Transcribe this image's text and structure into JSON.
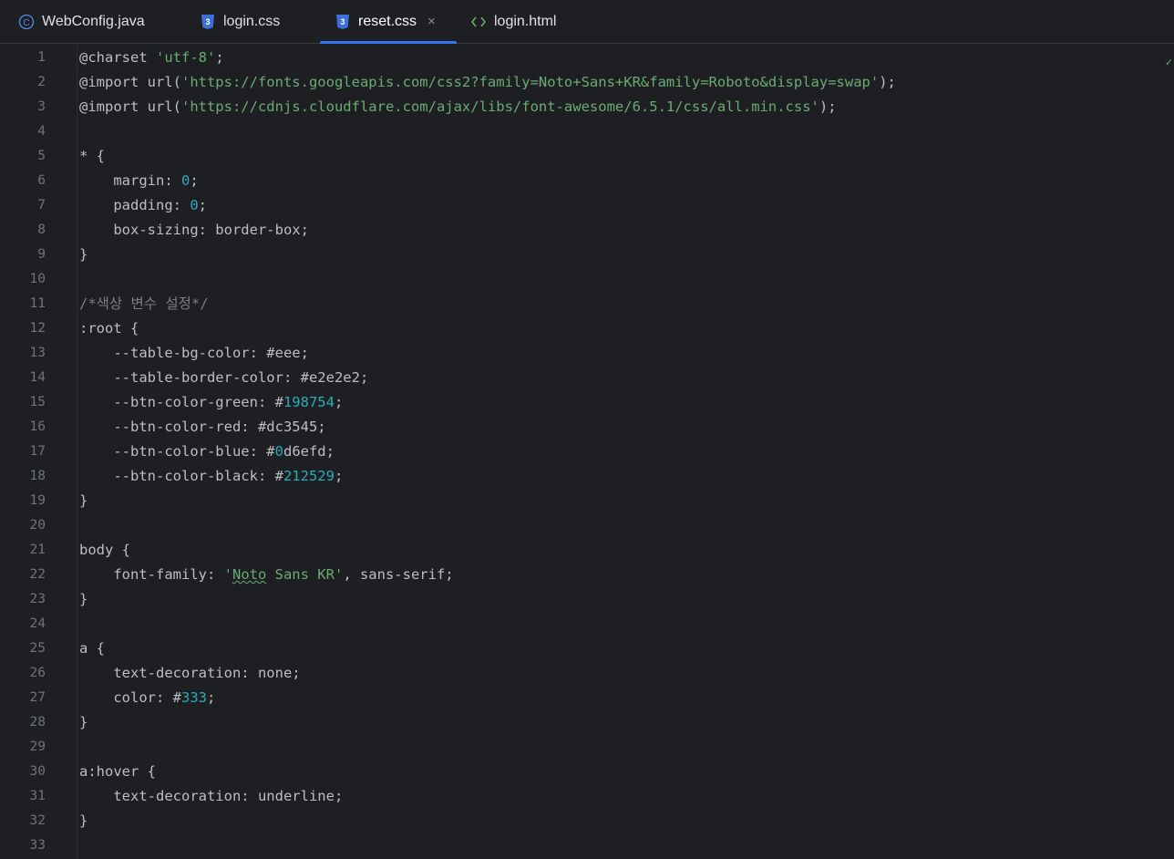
{
  "tabs": [
    {
      "label": "WebConfig.java",
      "icon": "java-class-icon",
      "active": false
    },
    {
      "label": "login.css",
      "icon": "css-file-icon",
      "active": false
    },
    {
      "label": "reset.css",
      "icon": "css-file-icon",
      "active": true,
      "close": "×"
    },
    {
      "label": "login.html",
      "icon": "html-file-icon",
      "active": false
    }
  ],
  "editor": {
    "file": "reset.css",
    "gutter_mark": "✓",
    "lines": [
      {
        "n": "1"
      },
      {
        "n": "2"
      },
      {
        "n": "3"
      },
      {
        "n": "4"
      },
      {
        "n": "5"
      },
      {
        "n": "6"
      },
      {
        "n": "7"
      },
      {
        "n": "8"
      },
      {
        "n": "9"
      },
      {
        "n": "10"
      },
      {
        "n": "11"
      },
      {
        "n": "12"
      },
      {
        "n": "13"
      },
      {
        "n": "14"
      },
      {
        "n": "15"
      },
      {
        "n": "16"
      },
      {
        "n": "17"
      },
      {
        "n": "18"
      },
      {
        "n": "19"
      },
      {
        "n": "20"
      },
      {
        "n": "21"
      },
      {
        "n": "22"
      },
      {
        "n": "23"
      },
      {
        "n": "24"
      },
      {
        "n": "25"
      },
      {
        "n": "26"
      },
      {
        "n": "27"
      },
      {
        "n": "28"
      },
      {
        "n": "29"
      },
      {
        "n": "30"
      },
      {
        "n": "31"
      },
      {
        "n": "32"
      },
      {
        "n": "33"
      }
    ],
    "code": {
      "l1a": "@charset ",
      "l1b": "'utf-8'",
      "l1c": ";",
      "l2a": "@import url(",
      "l2b": "'https://fonts.googleapis.com/css2?family=Noto+Sans+KR&family=Roboto&display=swap'",
      "l2c": ");",
      "l3a": "@import url(",
      "l3b": "'https://cdnjs.cloudflare.com/ajax/libs/font-awesome/6.5.1/css/all.min.css'",
      "l3c": ");",
      "l5": "* {",
      "l6a": "    margin: ",
      "l6b": "0",
      "l6c": ";",
      "l7a": "    padding: ",
      "l7b": "0",
      "l7c": ";",
      "l8": "    box-sizing: border-box;",
      "l9": "}",
      "l11": "/*색상 변수 설정*/",
      "l12": ":root {",
      "l13": "    --table-bg-color: #eee;",
      "l14": "    --table-border-color: #e2e2e2;",
      "l15a": "    --btn-color-green: #",
      "l15b": "198754",
      "l15c": ";",
      "l16": "    --btn-color-red: #dc3545;",
      "l17a": "    --btn-color-blue: #",
      "l17b": "0",
      "l17c": "d6efd;",
      "l18a": "    --btn-color-black: #",
      "l18b": "212529",
      "l18c": ";",
      "l19": "}",
      "l21": "body {",
      "l22a": "    font-family: ",
      "l22b": "'",
      "l22c": "Noto",
      "l22d": " Sans KR'",
      "l22e": ", sans-serif;",
      "l23": "}",
      "l25": "a {",
      "l26": "    text-decoration: none;",
      "l27a": "    color: #",
      "l27b": "333",
      "l27c": ";",
      "l28": "}",
      "l30": "a:hover {",
      "l31": "    text-decoration: underline;",
      "l32": "}"
    }
  }
}
